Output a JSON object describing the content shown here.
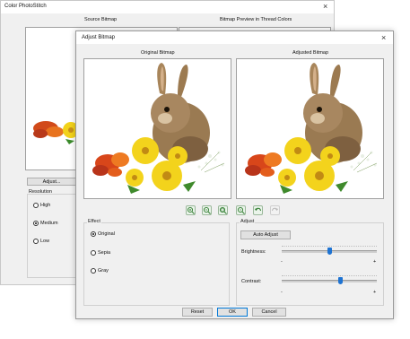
{
  "back_dialog": {
    "title": "Color PhotoStitch",
    "close": "×",
    "source_header": "Source Bitmap",
    "preview_header": "Bitmap Preview in Thread Colors",
    "adjust_button": "Adjust...",
    "resolution_label": "Resolution",
    "resolution_options": [
      "High",
      "Medium",
      "Low"
    ],
    "resolution_selected": "Medium"
  },
  "adjust_dialog": {
    "title": "Adjust Bitmap",
    "close": "×",
    "original_header": "Original Bitmap",
    "adjusted_header": "Adjusted Bitmap",
    "toolbar_icons": [
      "zoom-in-icon",
      "zoom-out-icon",
      "zoom-fit-icon",
      "zoom-actual-icon",
      "undo-icon",
      "redo-icon"
    ],
    "effect": {
      "label": "Effect",
      "options": [
        "Original",
        "Sepia",
        "Gray"
      ],
      "selected": "Original"
    },
    "adjust": {
      "label": "Adjust",
      "auto_adjust_button": "Auto Adjust",
      "brightness_label": "Brightness:",
      "brightness_value": 0.5,
      "contrast_label": "Contrast:",
      "contrast_value": 0.62,
      "minus": "-",
      "plus": "+"
    },
    "buttons": {
      "reset": "Reset",
      "ok": "OK",
      "cancel": "Cancel"
    }
  },
  "colors": {
    "accent": "#1e73d2",
    "ok_border": "#0078d7",
    "dialog_bg": "#f0f0f0"
  }
}
